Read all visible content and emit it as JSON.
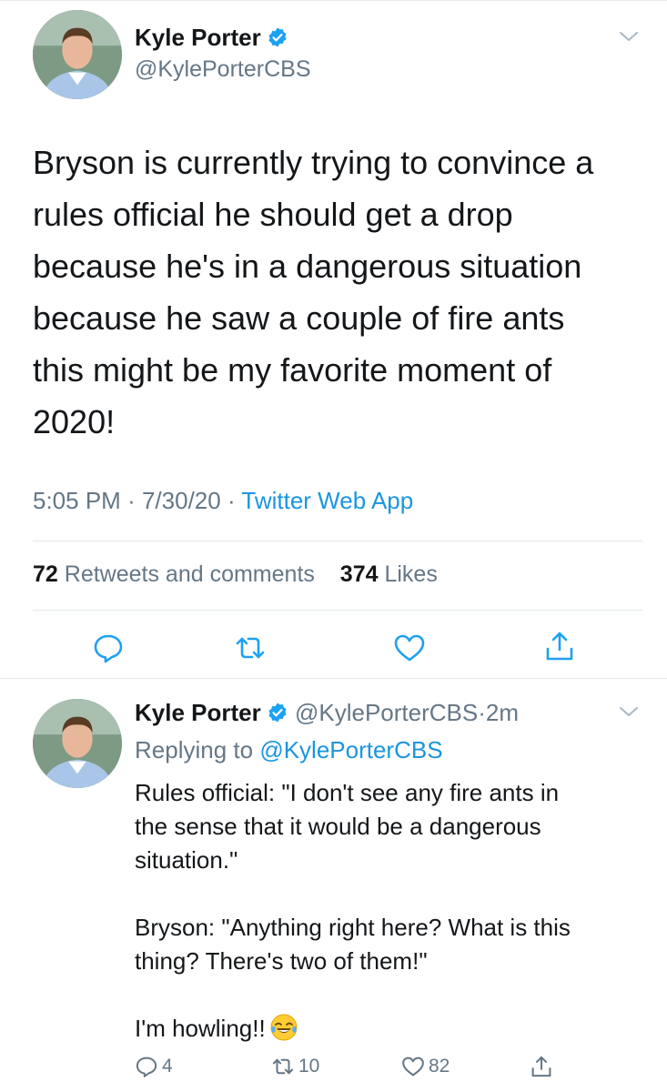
{
  "colors": {
    "link": "#1b95e0",
    "secondary": "#657786",
    "text": "#14171a",
    "divider": "#e1e8ed",
    "verified": "#1da1f2"
  },
  "main_tweet": {
    "author": {
      "name": "Kyle Porter",
      "handle": "@KylePorterCBS",
      "verified": true
    },
    "text": "Bryson is currently trying to convince a\nrules official he should get a drop\nbecause he's in a dangerous situation\nbecause he saw a couple of fire ants\nthis might be my favorite moment of\n2020!",
    "time": "5:05 PM",
    "date": "7/30/20",
    "dot": "·",
    "source": "Twitter Web App",
    "stats": {
      "retweets_count": "72",
      "retweets_label": "Retweets and comments",
      "likes_count": "374",
      "likes_label": "Likes"
    },
    "actions": [
      "reply-icon",
      "retweet-icon",
      "like-icon",
      "share-icon"
    ]
  },
  "reply_tweet": {
    "author": {
      "name": "Kyle Porter",
      "handle": "@KylePorterCBS",
      "verified": true
    },
    "time_ago": "2m",
    "dot": "·",
    "replying_label": "Replying to",
    "replying_handle": "@KylePorterCBS",
    "text": "Rules official: \"I don't see any fire ants in\nthe sense that it would be a dangerous\nsituation.\"\n\nBryson: \"Anything right here? What is this\nthing? There's two of them!\"\n\nI'm howling!!",
    "emoji": "face-with-tears-of-joy-icon",
    "counts": {
      "replies": "4",
      "retweets": "10",
      "likes": "82"
    }
  }
}
